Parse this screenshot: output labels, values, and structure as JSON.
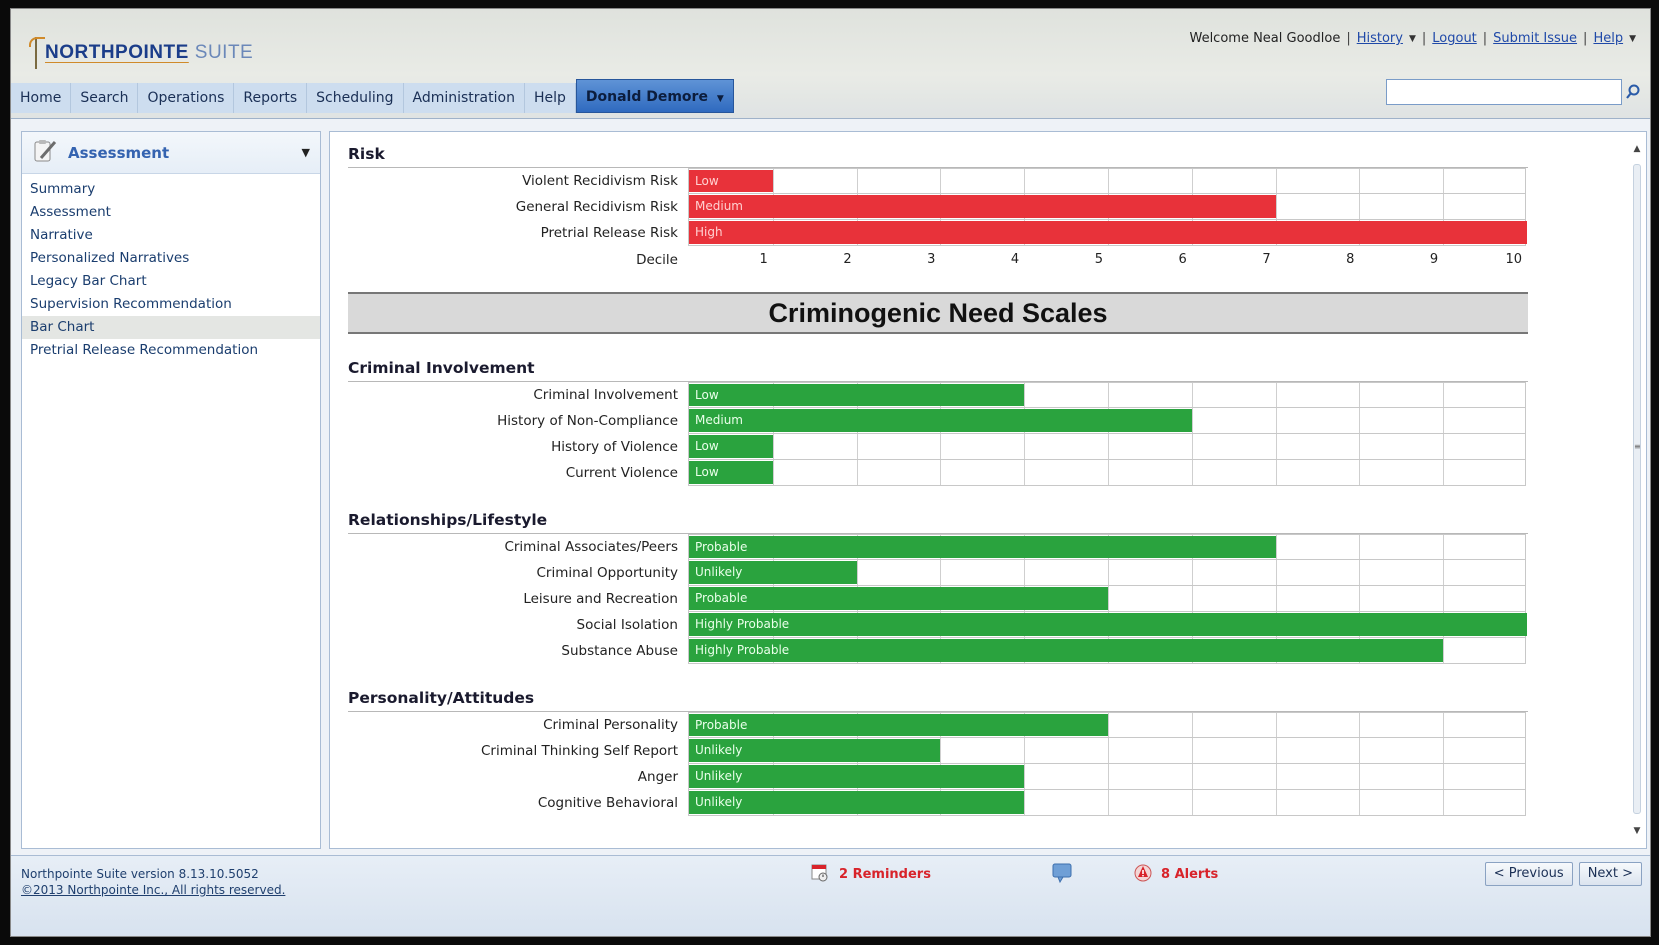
{
  "header": {
    "logo_brand": "NORTHPOINTE",
    "logo_suite": "SUITE",
    "welcome": "Welcome Neal Goodloe",
    "links": [
      "History",
      "Logout",
      "Submit Issue",
      "Help"
    ]
  },
  "nav": {
    "items": [
      "Home",
      "Search",
      "Operations",
      "Reports",
      "Scheduling",
      "Administration",
      "Help"
    ],
    "active": "Donald Demore"
  },
  "search": {
    "placeholder": ""
  },
  "sidebar": {
    "title": "Assessment",
    "items": [
      "Summary",
      "Assessment",
      "Narrative",
      "Personalized Narratives",
      "Legacy Bar Chart",
      "Supervision Recommendation",
      "Bar Chart",
      "Pretrial Release Recommendation"
    ],
    "selected": "Bar Chart"
  },
  "chart_data": {
    "type": "bar",
    "x_max": 10,
    "decile_label": "Decile",
    "ticks": [
      "1",
      "2",
      "3",
      "4",
      "5",
      "6",
      "7",
      "8",
      "9",
      "10"
    ],
    "band_title": "Criminogenic Need Scales",
    "sections": [
      {
        "title": "Risk",
        "color": "#e8323a",
        "rows": [
          {
            "label": "Violent Recidivism Risk",
            "value": 1,
            "level": "Low"
          },
          {
            "label": "General Recidivism Risk",
            "value": 7,
            "level": "Medium"
          },
          {
            "label": "Pretrial Release Risk",
            "value": 10,
            "level": "High"
          }
        ]
      },
      {
        "title": "Criminal Involvement",
        "color": "#2aa33e",
        "rows": [
          {
            "label": "Criminal Involvement",
            "value": 4,
            "level": "Low"
          },
          {
            "label": "History of Non-Compliance",
            "value": 6,
            "level": "Medium"
          },
          {
            "label": "History of Violence",
            "value": 1,
            "level": "Low"
          },
          {
            "label": "Current Violence",
            "value": 1,
            "level": "Low"
          }
        ]
      },
      {
        "title": "Relationships/Lifestyle",
        "color": "#2aa33e",
        "rows": [
          {
            "label": "Criminal Associates/Peers",
            "value": 7,
            "level": "Probable"
          },
          {
            "label": "Criminal Opportunity",
            "value": 2,
            "level": "Unlikely"
          },
          {
            "label": "Leisure and Recreation",
            "value": 5,
            "level": "Probable"
          },
          {
            "label": "Social Isolation",
            "value": 10,
            "level": "Highly Probable"
          },
          {
            "label": "Substance Abuse",
            "value": 9,
            "level": "Highly Probable"
          }
        ]
      },
      {
        "title": "Personality/Attitudes",
        "color": "#2aa33e",
        "rows": [
          {
            "label": "Criminal Personality",
            "value": 5,
            "level": "Probable"
          },
          {
            "label": "Criminal Thinking Self Report",
            "value": 3,
            "level": "Unlikely"
          },
          {
            "label": "Anger",
            "value": 4,
            "level": "Unlikely"
          },
          {
            "label": "Cognitive Behavioral",
            "value": 4,
            "level": "Unlikely"
          }
        ]
      }
    ]
  },
  "footer": {
    "version": "Northpointe Suite version 8.13.10.5052",
    "copyright": "©2013 Northpointe Inc., All rights reserved.",
    "reminders": "2 Reminders",
    "alerts": "8 Alerts",
    "prev": "< Previous",
    "next": "Next >"
  }
}
